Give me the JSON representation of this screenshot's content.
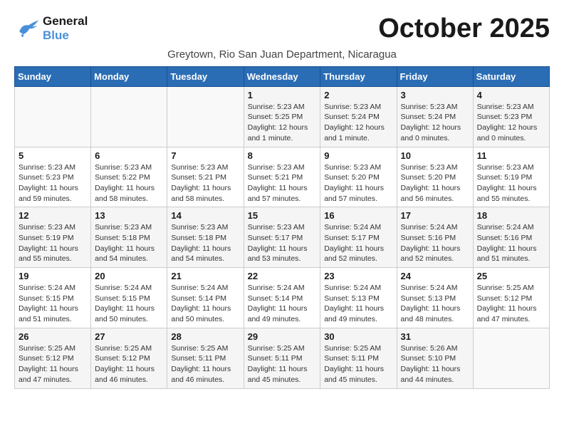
{
  "header": {
    "logo_line1": "General",
    "logo_line2": "Blue",
    "month_title": "October 2025",
    "location": "Greytown, Rio San Juan Department, Nicaragua"
  },
  "weekdays": [
    "Sunday",
    "Monday",
    "Tuesday",
    "Wednesday",
    "Thursday",
    "Friday",
    "Saturday"
  ],
  "weeks": [
    [
      {
        "num": "",
        "info": ""
      },
      {
        "num": "",
        "info": ""
      },
      {
        "num": "",
        "info": ""
      },
      {
        "num": "1",
        "info": "Sunrise: 5:23 AM\nSunset: 5:25 PM\nDaylight: 12 hours\nand 1 minute."
      },
      {
        "num": "2",
        "info": "Sunrise: 5:23 AM\nSunset: 5:24 PM\nDaylight: 12 hours\nand 1 minute."
      },
      {
        "num": "3",
        "info": "Sunrise: 5:23 AM\nSunset: 5:24 PM\nDaylight: 12 hours\nand 0 minutes."
      },
      {
        "num": "4",
        "info": "Sunrise: 5:23 AM\nSunset: 5:23 PM\nDaylight: 12 hours\nand 0 minutes."
      }
    ],
    [
      {
        "num": "5",
        "info": "Sunrise: 5:23 AM\nSunset: 5:23 PM\nDaylight: 11 hours\nand 59 minutes."
      },
      {
        "num": "6",
        "info": "Sunrise: 5:23 AM\nSunset: 5:22 PM\nDaylight: 11 hours\nand 58 minutes."
      },
      {
        "num": "7",
        "info": "Sunrise: 5:23 AM\nSunset: 5:21 PM\nDaylight: 11 hours\nand 58 minutes."
      },
      {
        "num": "8",
        "info": "Sunrise: 5:23 AM\nSunset: 5:21 PM\nDaylight: 11 hours\nand 57 minutes."
      },
      {
        "num": "9",
        "info": "Sunrise: 5:23 AM\nSunset: 5:20 PM\nDaylight: 11 hours\nand 57 minutes."
      },
      {
        "num": "10",
        "info": "Sunrise: 5:23 AM\nSunset: 5:20 PM\nDaylight: 11 hours\nand 56 minutes."
      },
      {
        "num": "11",
        "info": "Sunrise: 5:23 AM\nSunset: 5:19 PM\nDaylight: 11 hours\nand 55 minutes."
      }
    ],
    [
      {
        "num": "12",
        "info": "Sunrise: 5:23 AM\nSunset: 5:19 PM\nDaylight: 11 hours\nand 55 minutes."
      },
      {
        "num": "13",
        "info": "Sunrise: 5:23 AM\nSunset: 5:18 PM\nDaylight: 11 hours\nand 54 minutes."
      },
      {
        "num": "14",
        "info": "Sunrise: 5:23 AM\nSunset: 5:18 PM\nDaylight: 11 hours\nand 54 minutes."
      },
      {
        "num": "15",
        "info": "Sunrise: 5:23 AM\nSunset: 5:17 PM\nDaylight: 11 hours\nand 53 minutes."
      },
      {
        "num": "16",
        "info": "Sunrise: 5:24 AM\nSunset: 5:17 PM\nDaylight: 11 hours\nand 52 minutes."
      },
      {
        "num": "17",
        "info": "Sunrise: 5:24 AM\nSunset: 5:16 PM\nDaylight: 11 hours\nand 52 minutes."
      },
      {
        "num": "18",
        "info": "Sunrise: 5:24 AM\nSunset: 5:16 PM\nDaylight: 11 hours\nand 51 minutes."
      }
    ],
    [
      {
        "num": "19",
        "info": "Sunrise: 5:24 AM\nSunset: 5:15 PM\nDaylight: 11 hours\nand 51 minutes."
      },
      {
        "num": "20",
        "info": "Sunrise: 5:24 AM\nSunset: 5:15 PM\nDaylight: 11 hours\nand 50 minutes."
      },
      {
        "num": "21",
        "info": "Sunrise: 5:24 AM\nSunset: 5:14 PM\nDaylight: 11 hours\nand 50 minutes."
      },
      {
        "num": "22",
        "info": "Sunrise: 5:24 AM\nSunset: 5:14 PM\nDaylight: 11 hours\nand 49 minutes."
      },
      {
        "num": "23",
        "info": "Sunrise: 5:24 AM\nSunset: 5:13 PM\nDaylight: 11 hours\nand 49 minutes."
      },
      {
        "num": "24",
        "info": "Sunrise: 5:24 AM\nSunset: 5:13 PM\nDaylight: 11 hours\nand 48 minutes."
      },
      {
        "num": "25",
        "info": "Sunrise: 5:25 AM\nSunset: 5:12 PM\nDaylight: 11 hours\nand 47 minutes."
      }
    ],
    [
      {
        "num": "26",
        "info": "Sunrise: 5:25 AM\nSunset: 5:12 PM\nDaylight: 11 hours\nand 47 minutes."
      },
      {
        "num": "27",
        "info": "Sunrise: 5:25 AM\nSunset: 5:12 PM\nDaylight: 11 hours\nand 46 minutes."
      },
      {
        "num": "28",
        "info": "Sunrise: 5:25 AM\nSunset: 5:11 PM\nDaylight: 11 hours\nand 46 minutes."
      },
      {
        "num": "29",
        "info": "Sunrise: 5:25 AM\nSunset: 5:11 PM\nDaylight: 11 hours\nand 45 minutes."
      },
      {
        "num": "30",
        "info": "Sunrise: 5:25 AM\nSunset: 5:11 PM\nDaylight: 11 hours\nand 45 minutes."
      },
      {
        "num": "31",
        "info": "Sunrise: 5:26 AM\nSunset: 5:10 PM\nDaylight: 11 hours\nand 44 minutes."
      },
      {
        "num": "",
        "info": ""
      }
    ]
  ]
}
